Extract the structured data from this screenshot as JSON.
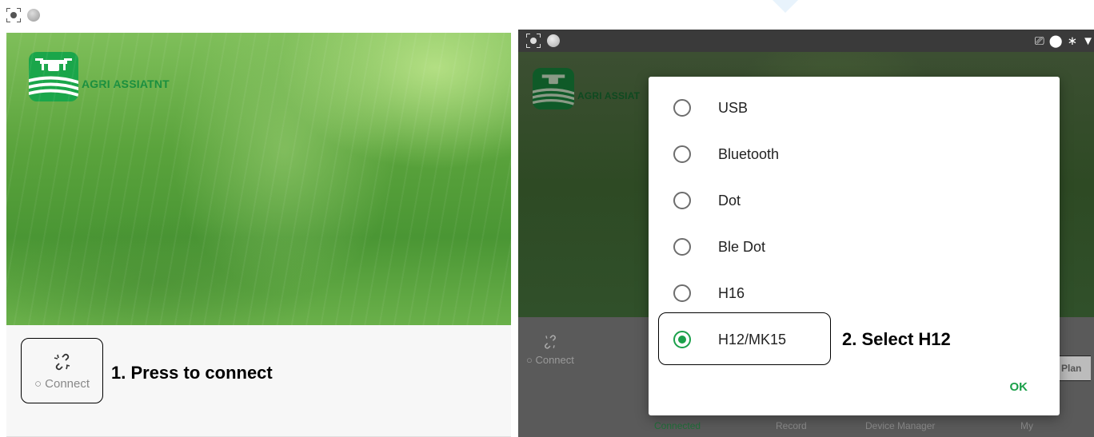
{
  "left_screen": {
    "app_name": "AGRI ASSIATNT",
    "connect_label": "○ Connect",
    "annotation": "1.  Press to connect"
  },
  "right_screen": {
    "app_name": "AGRI ASSIAT",
    "connect_label": "○ Connect",
    "plan_label": "Plan",
    "dialog": {
      "options": [
        {
          "label": "USB",
          "checked": false
        },
        {
          "label": "Bluetooth",
          "checked": false
        },
        {
          "label": "Dot",
          "checked": false
        },
        {
          "label": "Ble Dot",
          "checked": false
        },
        {
          "label": "H16",
          "checked": false
        },
        {
          "label": "H12/MK15",
          "checked": true
        }
      ],
      "ok_label": "OK",
      "annotation": "2.  Select H12"
    },
    "tabs": [
      "Connected",
      "Record",
      "Device Manager",
      "My"
    ]
  },
  "colors": {
    "accent_green": "#1ba04a",
    "logo_text_green": "#1a8f3e"
  }
}
